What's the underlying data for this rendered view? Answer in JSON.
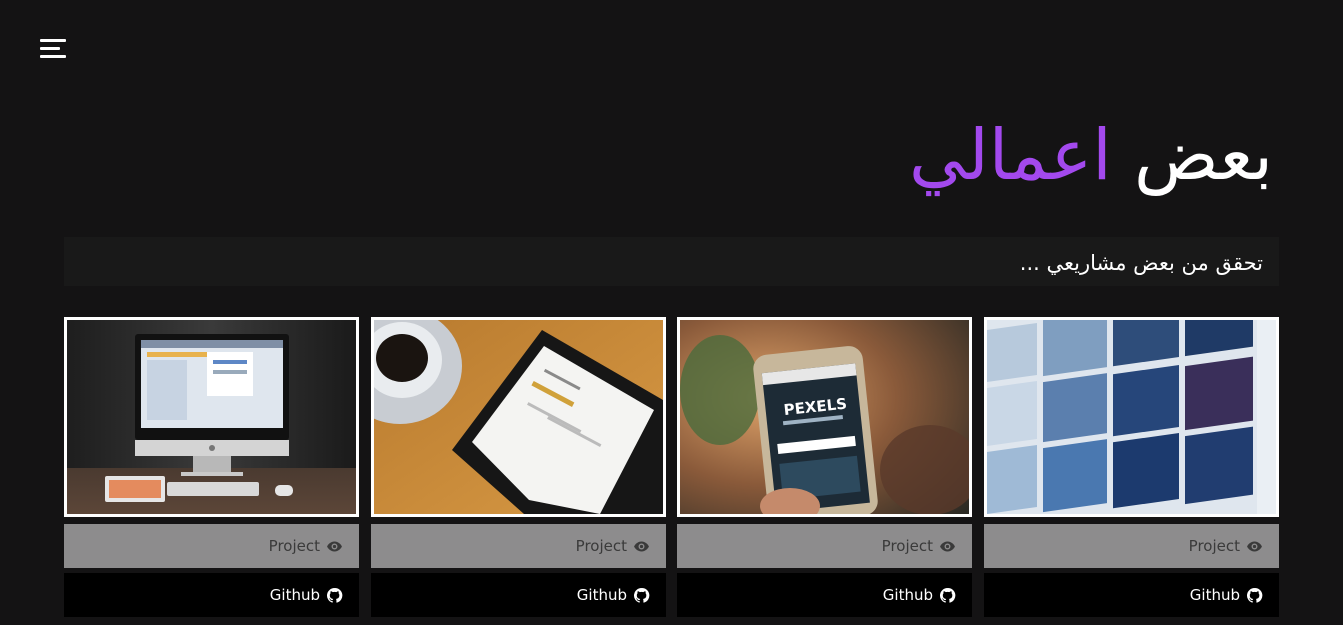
{
  "nav": {
    "menu_icon": "hamburger-menu-icon"
  },
  "section": {
    "title_part1": "بعض",
    "title_part2": "اعمالي",
    "accent_color": "#a349ee",
    "subtitle": "تحقق من بعض مشاريعي ..."
  },
  "projects": [
    {
      "project_label": "Project",
      "project_icon": "eye-icon",
      "github_label": "Github",
      "github_icon": "github-icon",
      "image": "imac-desk-photo"
    },
    {
      "project_label": "Project",
      "project_icon": "eye-icon",
      "github_label": "Github",
      "github_icon": "github-icon",
      "image": "tablet-coffee-photo"
    },
    {
      "project_label": "Project",
      "project_icon": "eye-icon",
      "github_label": "Github",
      "github_icon": "github-icon",
      "image": "phone-pexels-photo"
    },
    {
      "project_label": "Project",
      "project_icon": "eye-icon",
      "github_label": "Github",
      "github_icon": "github-icon",
      "image": "video-wall-photo"
    }
  ],
  "colors": {
    "background": "#141314",
    "project_button": "#8d8c8d",
    "github_button": "#000000"
  }
}
